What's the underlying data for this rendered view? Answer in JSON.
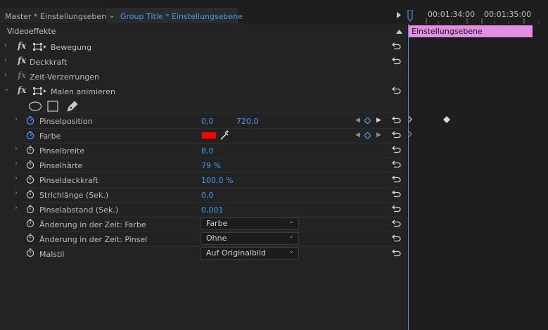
{
  "tabs": {
    "master": "Master * Einstellungsebene",
    "active_chevron": "⌄",
    "group": "Group Title * Einstellungsebene"
  },
  "timeline": {
    "tc1": "00:01:34:00",
    "tc2": "00:01:35:00",
    "clip_label": "Einstellungsebene",
    "clip_color": "#e38de3",
    "playhead_color": "#4f8cd9"
  },
  "header": {
    "title": "Videoeffekte"
  },
  "effects": {
    "bewegung": "Bewegung",
    "deckkraft": "Deckkraft",
    "zeit": "Zeit-Verzerrungen",
    "malen": "Malen animieren",
    "fx": "fx"
  },
  "params": {
    "pinselposition": {
      "label": "Pinselposition",
      "x": "0,0",
      "y": "720,0"
    },
    "farbe": {
      "label": "Farbe",
      "color": "#ff0000"
    },
    "pinselbreite": {
      "label": "Pinselbreite",
      "value": "8,0"
    },
    "pinselhaerte": {
      "label": "Pinselhärte",
      "value": "79 %"
    },
    "pinseldeckkraft": {
      "label": "Pinseldeckkraft",
      "value": "100,0 %"
    },
    "strichlaenge": {
      "label": "Strichlänge (Sek.)",
      "value": "0,0"
    },
    "pinselabstand": {
      "label": "Pinselabstand (Sek.)",
      "value": "0,001"
    },
    "aend_farbe": {
      "label": "Änderung in der Zeit: Farbe",
      "value": "Farbe"
    },
    "aend_pinsel": {
      "label": "Änderung in der Zeit: Pinsel",
      "value": "Ohne"
    },
    "malstil": {
      "label": "Malstil",
      "value": "Auf Originalbild"
    }
  }
}
